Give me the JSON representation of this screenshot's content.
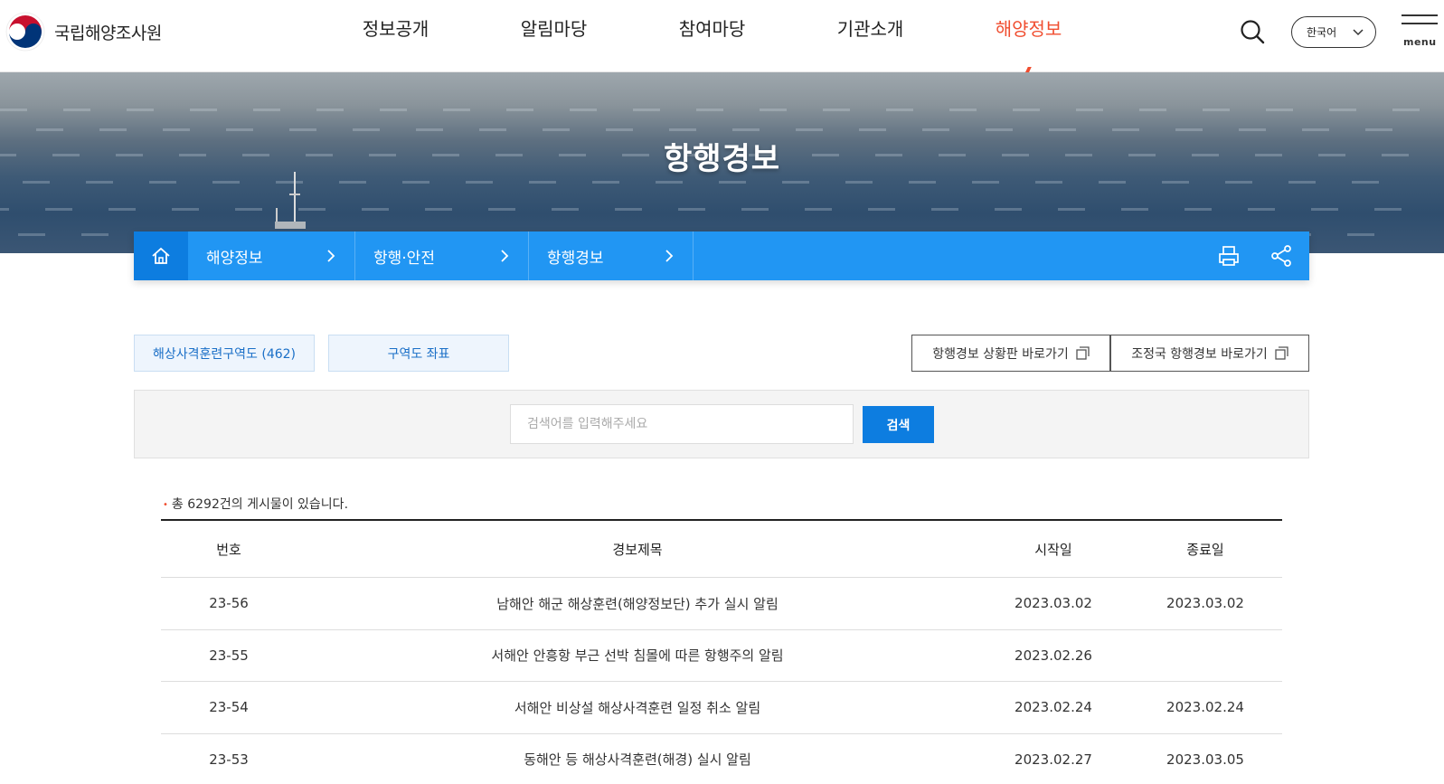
{
  "header": {
    "logo_text": "국립해양조사원",
    "nav": [
      {
        "label": "정보공개"
      },
      {
        "label": "알림마당"
      },
      {
        "label": "참여마당"
      },
      {
        "label": "기관소개"
      },
      {
        "label": "해양정보",
        "active": true
      }
    ],
    "language": "한국어",
    "menu_label": "menu",
    "accent_color": "#f04e30"
  },
  "hero": {
    "title": "항행경보"
  },
  "breadcrumb": {
    "home_icon": "home-icon",
    "items": [
      "해양정보",
      "항행·안전",
      "항행경보"
    ],
    "actions": [
      "print-icon",
      "share-icon"
    ],
    "bar_color": "#2196f3"
  },
  "tabs": {
    "training_zone": "해상사격훈련구역도 (462)",
    "coordinates": "구역도 좌표"
  },
  "links": {
    "status_board": "항행경보 상황판 바로가기",
    "joseongguk": "조정국 항행경보 바로가기"
  },
  "search": {
    "placeholder": "검색어를 입력해주세요",
    "button": "검색"
  },
  "list": {
    "count_text": "총 6292건의 게시물이 있습니다.",
    "columns": {
      "no": "번호",
      "title": "경보제목",
      "start": "시작일",
      "end": "종료일"
    },
    "rows": [
      {
        "no": "23-56",
        "title": "남해안 해군 해상훈련(해양정보단) 추가 실시 알림",
        "start": "2023.03.02",
        "end": "2023.03.02"
      },
      {
        "no": "23-55",
        "title": "서해안 안흥항 부근 선박 침몰에 따른 항행주의 알림",
        "start": "2023.02.26",
        "end": ""
      },
      {
        "no": "23-54",
        "title": "서해안 비상설 해상사격훈련 일정 취소 알림",
        "start": "2023.02.24",
        "end": "2023.02.24"
      },
      {
        "no": "23-53",
        "title": "동해안 등 해상사격훈련(해경) 실시 알림",
        "start": "2023.02.27",
        "end": "2023.03.05"
      }
    ]
  }
}
